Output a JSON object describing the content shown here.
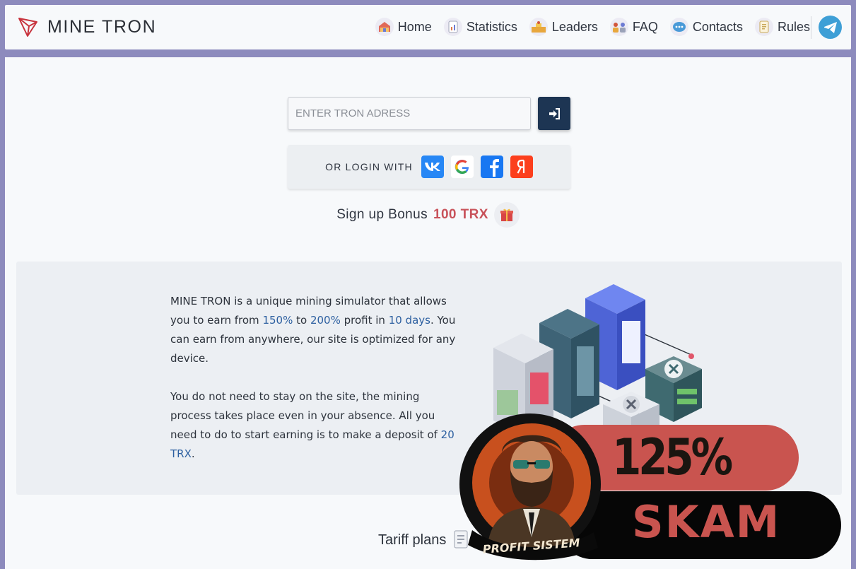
{
  "brand": {
    "name": "MINE TRON"
  },
  "nav": {
    "items": [
      {
        "label": "Home",
        "icon": "home-icon"
      },
      {
        "label": "Statistics",
        "icon": "statistics-icon"
      },
      {
        "label": "Leaders",
        "icon": "leaders-icon"
      },
      {
        "label": "FAQ",
        "icon": "faq-icon"
      },
      {
        "label": "Contacts",
        "icon": "contacts-icon"
      },
      {
        "label": "Rules",
        "icon": "rules-icon"
      }
    ],
    "telegram_icon": "telegram-icon"
  },
  "login": {
    "placeholder": "ENTER TRON ADRESS",
    "submit_icon": "sign-in-icon",
    "social_label": "OR LOGIN WITH",
    "providers": [
      "vk",
      "google",
      "facebook",
      "yandex"
    ]
  },
  "bonus": {
    "text": "Sign up Bonus",
    "amount": "100 TRX",
    "icon": "gift-icon"
  },
  "about": {
    "p1": {
      "a": "MINE TRON is a unique mining simulator that allows you to earn from ",
      "min": "150%",
      "b": " to ",
      "max": "200%",
      "c": " profit in ",
      "days": "10 days",
      "d": ". You can earn from anywhere, our site is optimized for any device."
    },
    "p2": {
      "a": "You do not need to stay on the site, the mining process takes place even in your absence. All you need to do to start earning is to make a deposit of ",
      "deposit": "20 TRX",
      "b": "."
    }
  },
  "tariff": {
    "title": "Tariff plans"
  },
  "overlay": {
    "percent": "125%",
    "word": "SKAM",
    "avatar_caption": "PROFIT SISTEM"
  },
  "colors": {
    "accent": "#c8525a",
    "dark_button": "#1d3553",
    "frame": "#8d8bbd",
    "badge_red": "#c9544f"
  }
}
